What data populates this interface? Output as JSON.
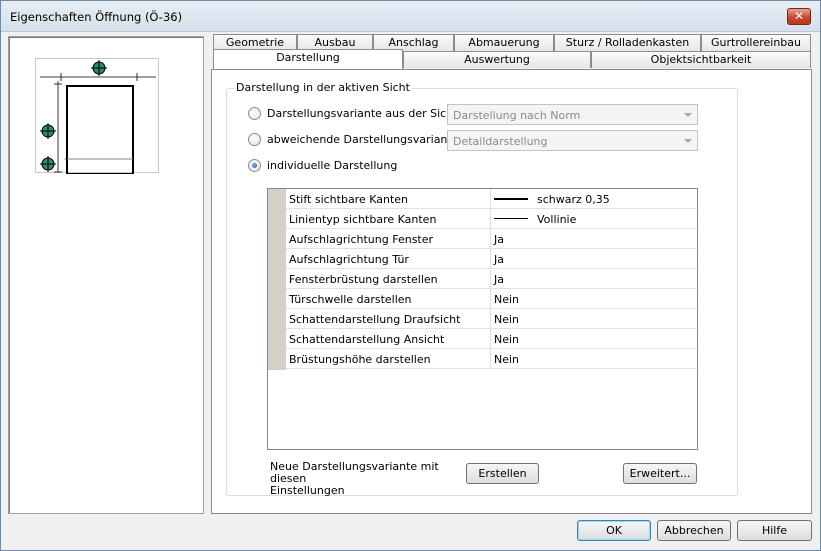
{
  "window": {
    "title": "Eigenschaften Öffnung (Ö-36)",
    "close_symbol": "✕"
  },
  "tabs": {
    "top_row": [
      "Geometrie",
      "Ausbau",
      "Anschlag",
      "Abmauerung",
      "Sturz / Rolladenkasten",
      "Gurtrollereinbau"
    ],
    "bottom_row": [
      "Darstellung",
      "Auswertung",
      "Objektsichtbarkeit"
    ],
    "active": "Darstellung"
  },
  "group": {
    "title": "Darstellung in der aktiven Sicht"
  },
  "options": [
    {
      "label": "Darstellungsvariante aus der Sicht",
      "selected": false,
      "combo": "Darstellung nach Norm"
    },
    {
      "label": "abweichende Darstellungsvariante",
      "selected": false,
      "combo": "Detaildarstellung"
    },
    {
      "label": "individuelle Darstellung",
      "selected": true
    }
  ],
  "properties": [
    {
      "name": "Stift sichtbare Kanten",
      "value": "schwarz 0,35",
      "line": "thick"
    },
    {
      "name": "Linientyp sichtbare Kanten",
      "value": "Vollinie",
      "line": "thin"
    },
    {
      "name": "Aufschlagrichtung Fenster",
      "value": "Ja"
    },
    {
      "name": "Aufschlagrichtung Tür",
      "value": "Ja"
    },
    {
      "name": "Fensterbrüstung darstellen",
      "value": "Ja"
    },
    {
      "name": "Türschwelle darstellen",
      "value": "Nein"
    },
    {
      "name": "Schattendarstellung Draufsicht",
      "value": "Nein"
    },
    {
      "name": "Schattendarstellung Ansicht",
      "value": "Nein"
    },
    {
      "name": "Brüstungshöhe darstellen",
      "value": "Nein"
    }
  ],
  "footer_group": {
    "text_line1": "Neue Darstellungsvariante mit diesen",
    "text_line2": "Einstellungen",
    "create_label": "Erstellen",
    "advanced_label": "Erweitert..."
  },
  "buttons": {
    "ok": "OK",
    "cancel": "Abbrechen",
    "help": "Hilfe"
  },
  "colors": {
    "marker_fill": "#2e8b72",
    "accent": "#3c7fb1"
  }
}
